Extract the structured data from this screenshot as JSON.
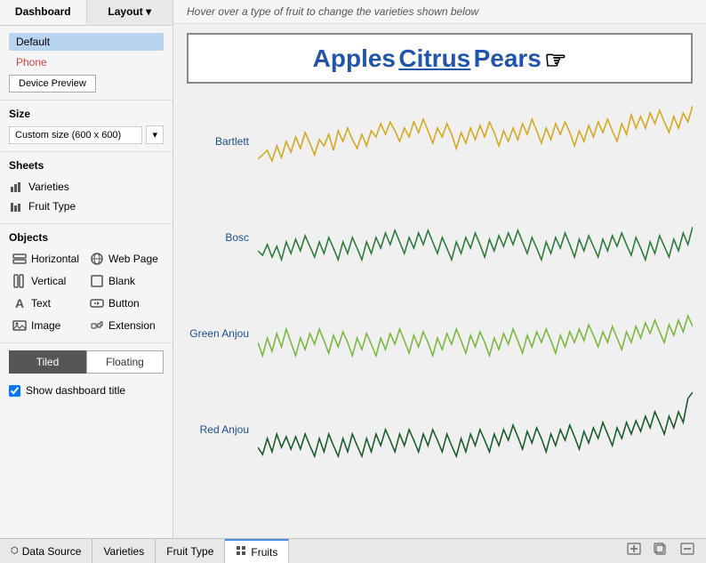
{
  "sidebar": {
    "tabs": [
      {
        "label": "Dashboard",
        "active": true
      },
      {
        "label": "Layout",
        "active": false,
        "has_dropdown": true
      }
    ],
    "size_section": {
      "label": "Size",
      "options": [
        "Default",
        "Phone"
      ],
      "default_active": "Default",
      "phone_label": "Phone",
      "device_preview_label": "Device Preview",
      "custom_size_label": "Custom size (600 x 600)"
    },
    "sheets_section": {
      "label": "Sheets",
      "items": [
        {
          "label": "Varieties",
          "icon": "bar-icon"
        },
        {
          "label": "Fruit Type",
          "icon": "bar-icon"
        }
      ]
    },
    "objects_section": {
      "label": "Objects",
      "items": [
        {
          "label": "Horizontal",
          "icon": "H-icon",
          "col": 1
        },
        {
          "label": "Web Page",
          "icon": "globe-icon",
          "col": 2
        },
        {
          "label": "Vertical",
          "icon": "V-icon",
          "col": 1
        },
        {
          "label": "Blank",
          "icon": "blank-icon",
          "col": 2
        },
        {
          "label": "Text",
          "icon": "A-icon",
          "col": 1
        },
        {
          "label": "Button",
          "icon": "button-icon",
          "col": 2
        },
        {
          "label": "Image",
          "icon": "img-icon",
          "col": 1
        },
        {
          "label": "Extension",
          "icon": "ext-icon",
          "col": 2
        }
      ]
    },
    "tiled_floating": {
      "tiled": "Tiled",
      "floating": "Floating",
      "active": "tiled"
    },
    "show_title": {
      "label": "Show dashboard title",
      "checked": true
    }
  },
  "main": {
    "hover_hint": "Hover over a type of fruit to change the varieties shown below",
    "title": {
      "apples": "Apples",
      "citrus": "Citrus",
      "pears": "Pears"
    },
    "chart_rows": [
      {
        "label": "Bartlett",
        "color": "#d4a820"
      },
      {
        "label": "Bosc",
        "color": "#2d7a3a"
      },
      {
        "label": "Green Anjou",
        "color": "#7ab840"
      },
      {
        "label": "Red Anjou",
        "color": "#1a5c2a"
      }
    ]
  },
  "bottom_tabs": {
    "items": [
      {
        "label": "Data Source",
        "icon": "",
        "active": false
      },
      {
        "label": "Varieties",
        "icon": "",
        "active": false
      },
      {
        "label": "Fruit Type",
        "icon": "",
        "active": false
      },
      {
        "label": "Fruits",
        "icon": "grid",
        "active": true
      }
    ],
    "action_icons": [
      "add-sheet",
      "duplicate-sheet",
      "remove-sheet"
    ]
  }
}
